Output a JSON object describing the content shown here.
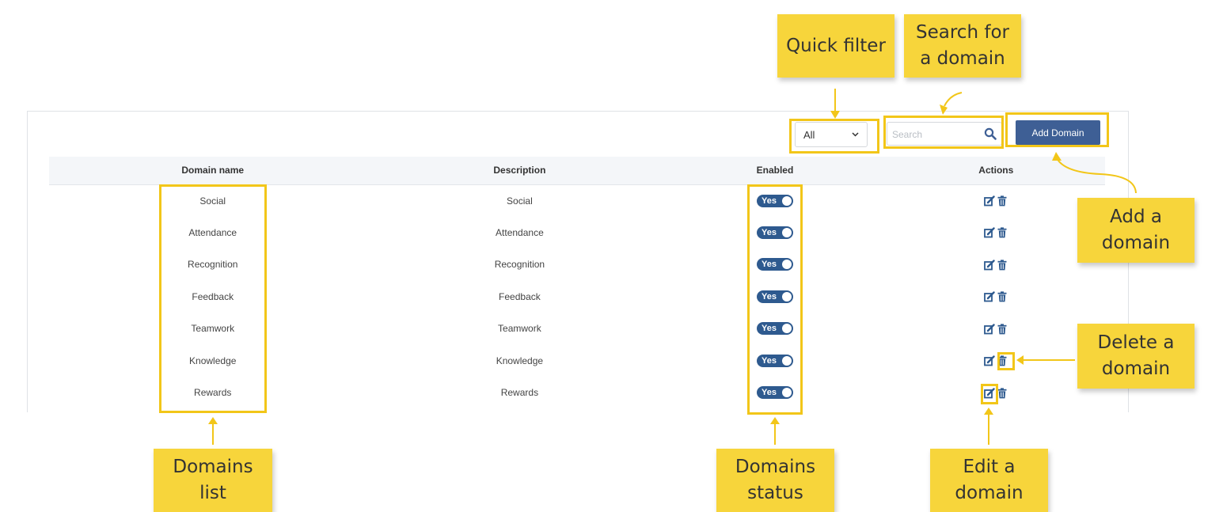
{
  "toolbar": {
    "filter_value": "All",
    "search_placeholder": "Search",
    "add_button_label": "Add Domain"
  },
  "table": {
    "columns": [
      "Domain name",
      "Description",
      "Enabled",
      "Actions"
    ],
    "rows": [
      {
        "name": "Social",
        "description": "Social",
        "enabled": "Yes"
      },
      {
        "name": "Attendance",
        "description": "Attendance",
        "enabled": "Yes"
      },
      {
        "name": "Recognition",
        "description": "Recognition",
        "enabled": "Yes"
      },
      {
        "name": "Feedback",
        "description": "Feedback",
        "enabled": "Yes"
      },
      {
        "name": "Teamwork",
        "description": "Teamwork",
        "enabled": "Yes"
      },
      {
        "name": "Knowledge",
        "description": "Knowledge",
        "enabled": "Yes"
      },
      {
        "name": "Rewards",
        "description": "Rewards",
        "enabled": "Yes"
      }
    ]
  },
  "annotations": {
    "quick_filter": [
      "Quick filter"
    ],
    "search": [
      "Search for",
      "a domain"
    ],
    "add": [
      "Add a",
      "domain"
    ],
    "delete": [
      "Delete a",
      "domain"
    ],
    "domains_list": [
      "Domains",
      "list"
    ],
    "domains_status": [
      "Domains",
      "status"
    ],
    "edit": [
      "Edit a",
      "domain"
    ]
  },
  "icons": {
    "search": "search-icon",
    "edit": "edit-icon",
    "delete": "trash-icon",
    "dropdown": "chevron-down-icon"
  },
  "colors": {
    "primary": "#3e5f95",
    "toggle": "#2e5a8f",
    "note": "#f7d53b",
    "highlight": "#f2c619"
  }
}
